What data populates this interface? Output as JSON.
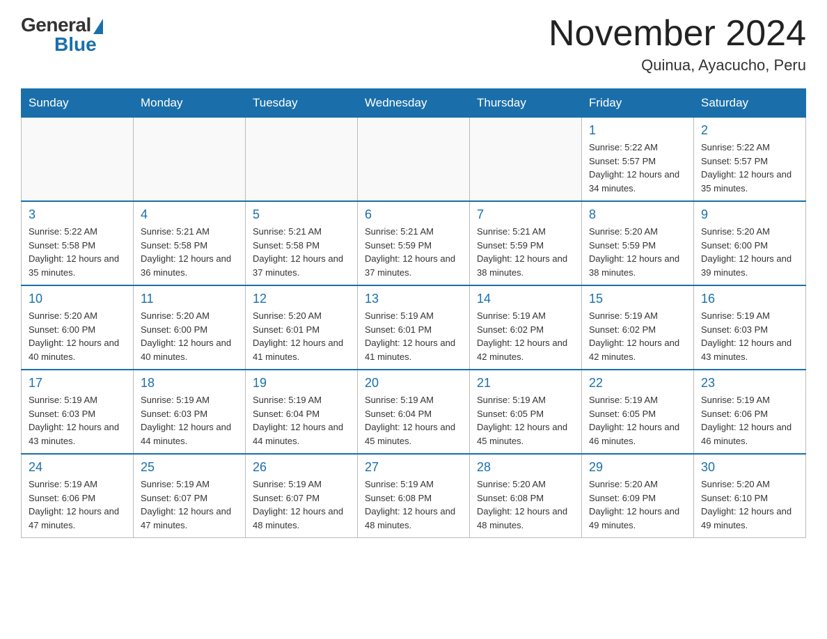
{
  "logo": {
    "general": "General",
    "blue": "Blue"
  },
  "header": {
    "month": "November 2024",
    "location": "Quinua, Ayacucho, Peru"
  },
  "weekdays": [
    "Sunday",
    "Monday",
    "Tuesday",
    "Wednesday",
    "Thursday",
    "Friday",
    "Saturday"
  ],
  "weeks": [
    [
      {
        "day": "",
        "info": ""
      },
      {
        "day": "",
        "info": ""
      },
      {
        "day": "",
        "info": ""
      },
      {
        "day": "",
        "info": ""
      },
      {
        "day": "",
        "info": ""
      },
      {
        "day": "1",
        "info": "Sunrise: 5:22 AM\nSunset: 5:57 PM\nDaylight: 12 hours and 34 minutes."
      },
      {
        "day": "2",
        "info": "Sunrise: 5:22 AM\nSunset: 5:57 PM\nDaylight: 12 hours and 35 minutes."
      }
    ],
    [
      {
        "day": "3",
        "info": "Sunrise: 5:22 AM\nSunset: 5:58 PM\nDaylight: 12 hours and 35 minutes."
      },
      {
        "day": "4",
        "info": "Sunrise: 5:21 AM\nSunset: 5:58 PM\nDaylight: 12 hours and 36 minutes."
      },
      {
        "day": "5",
        "info": "Sunrise: 5:21 AM\nSunset: 5:58 PM\nDaylight: 12 hours and 37 minutes."
      },
      {
        "day": "6",
        "info": "Sunrise: 5:21 AM\nSunset: 5:59 PM\nDaylight: 12 hours and 37 minutes."
      },
      {
        "day": "7",
        "info": "Sunrise: 5:21 AM\nSunset: 5:59 PM\nDaylight: 12 hours and 38 minutes."
      },
      {
        "day": "8",
        "info": "Sunrise: 5:20 AM\nSunset: 5:59 PM\nDaylight: 12 hours and 38 minutes."
      },
      {
        "day": "9",
        "info": "Sunrise: 5:20 AM\nSunset: 6:00 PM\nDaylight: 12 hours and 39 minutes."
      }
    ],
    [
      {
        "day": "10",
        "info": "Sunrise: 5:20 AM\nSunset: 6:00 PM\nDaylight: 12 hours and 40 minutes."
      },
      {
        "day": "11",
        "info": "Sunrise: 5:20 AM\nSunset: 6:00 PM\nDaylight: 12 hours and 40 minutes."
      },
      {
        "day": "12",
        "info": "Sunrise: 5:20 AM\nSunset: 6:01 PM\nDaylight: 12 hours and 41 minutes."
      },
      {
        "day": "13",
        "info": "Sunrise: 5:19 AM\nSunset: 6:01 PM\nDaylight: 12 hours and 41 minutes."
      },
      {
        "day": "14",
        "info": "Sunrise: 5:19 AM\nSunset: 6:02 PM\nDaylight: 12 hours and 42 minutes."
      },
      {
        "day": "15",
        "info": "Sunrise: 5:19 AM\nSunset: 6:02 PM\nDaylight: 12 hours and 42 minutes."
      },
      {
        "day": "16",
        "info": "Sunrise: 5:19 AM\nSunset: 6:03 PM\nDaylight: 12 hours and 43 minutes."
      }
    ],
    [
      {
        "day": "17",
        "info": "Sunrise: 5:19 AM\nSunset: 6:03 PM\nDaylight: 12 hours and 43 minutes."
      },
      {
        "day": "18",
        "info": "Sunrise: 5:19 AM\nSunset: 6:03 PM\nDaylight: 12 hours and 44 minutes."
      },
      {
        "day": "19",
        "info": "Sunrise: 5:19 AM\nSunset: 6:04 PM\nDaylight: 12 hours and 44 minutes."
      },
      {
        "day": "20",
        "info": "Sunrise: 5:19 AM\nSunset: 6:04 PM\nDaylight: 12 hours and 45 minutes."
      },
      {
        "day": "21",
        "info": "Sunrise: 5:19 AM\nSunset: 6:05 PM\nDaylight: 12 hours and 45 minutes."
      },
      {
        "day": "22",
        "info": "Sunrise: 5:19 AM\nSunset: 6:05 PM\nDaylight: 12 hours and 46 minutes."
      },
      {
        "day": "23",
        "info": "Sunrise: 5:19 AM\nSunset: 6:06 PM\nDaylight: 12 hours and 46 minutes."
      }
    ],
    [
      {
        "day": "24",
        "info": "Sunrise: 5:19 AM\nSunset: 6:06 PM\nDaylight: 12 hours and 47 minutes."
      },
      {
        "day": "25",
        "info": "Sunrise: 5:19 AM\nSunset: 6:07 PM\nDaylight: 12 hours and 47 minutes."
      },
      {
        "day": "26",
        "info": "Sunrise: 5:19 AM\nSunset: 6:07 PM\nDaylight: 12 hours and 48 minutes."
      },
      {
        "day": "27",
        "info": "Sunrise: 5:19 AM\nSunset: 6:08 PM\nDaylight: 12 hours and 48 minutes."
      },
      {
        "day": "28",
        "info": "Sunrise: 5:20 AM\nSunset: 6:08 PM\nDaylight: 12 hours and 48 minutes."
      },
      {
        "day": "29",
        "info": "Sunrise: 5:20 AM\nSunset: 6:09 PM\nDaylight: 12 hours and 49 minutes."
      },
      {
        "day": "30",
        "info": "Sunrise: 5:20 AM\nSunset: 6:10 PM\nDaylight: 12 hours and 49 minutes."
      }
    ]
  ]
}
